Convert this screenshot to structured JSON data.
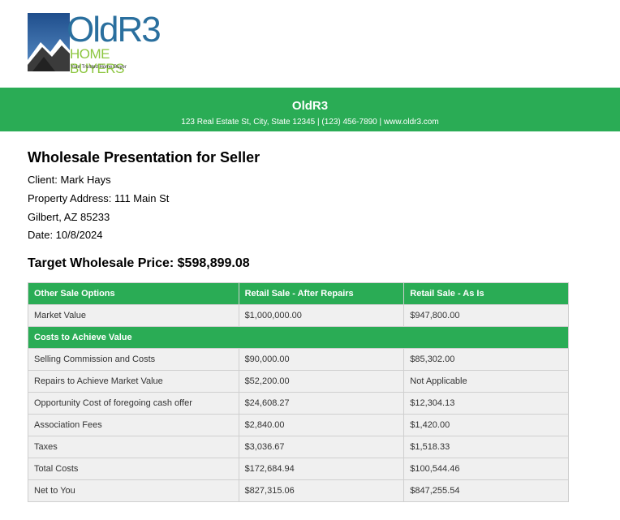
{
  "logo": {
    "title": "OldR3",
    "subtitle": "HOME BUYERS",
    "tagline": "Your Trusted Home Buyer"
  },
  "header": {
    "company": "OldR3",
    "contact": "123 Real Estate St, City, State 12345 | (123) 456-7890 | www.oldr3.com"
  },
  "document": {
    "title": "Wholesale Presentation for Seller",
    "client": "Client: Mark Hays",
    "address_line1": "Property Address: 111 Main St",
    "address_line2": "Gilbert, AZ 85233",
    "date": "Date: 10/8/2024",
    "target_price": "Target Wholesale Price: $598,899.08"
  },
  "table": {
    "headers": [
      "Other Sale Options",
      "Retail Sale - After Repairs",
      "Retail Sale - As Is"
    ],
    "market_value": [
      "Market Value",
      "$1,000,000.00",
      "$947,800.00"
    ],
    "section_title": "Costs to Achieve Value",
    "rows": [
      [
        "Selling Commission and Costs",
        "$90,000.00",
        "$85,302.00"
      ],
      [
        "Repairs to Achieve Market Value",
        "$52,200.00",
        "Not Applicable"
      ],
      [
        "Opportunity Cost of foregoing cash offer",
        "$24,608.27",
        "$12,304.13"
      ],
      [
        "Association Fees",
        "$2,840.00",
        "$1,420.00"
      ],
      [
        "Taxes",
        "$3,036.67",
        "$1,518.33"
      ],
      [
        "Total Costs",
        "$172,684.94",
        "$100,544.46"
      ],
      [
        "Net to You",
        "$827,315.06",
        "$847,255.54"
      ]
    ]
  },
  "colors": {
    "brand_green": "#2aac55",
    "logo_blue": "#2a6f9e",
    "logo_lime": "#8cc63f"
  }
}
